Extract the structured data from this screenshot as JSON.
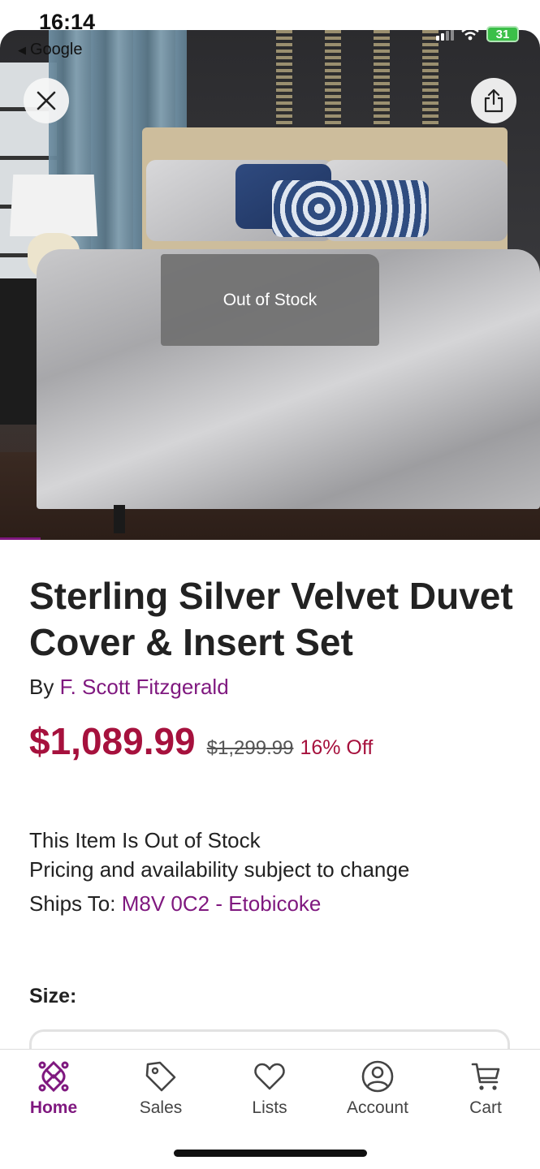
{
  "status_bar": {
    "time": "16:14",
    "back_app": "Google",
    "battery": "31"
  },
  "hero": {
    "overlay_text": "Out of Stock",
    "close_icon": "close-icon",
    "share_icon": "share-icon"
  },
  "product": {
    "title": "Sterling Silver Velvet Duvet Cover & Insert Set",
    "by_prefix": "By",
    "brand": "F. Scott Fitzgerald",
    "price": "$1,089.99",
    "old_price": "$1,299.99",
    "discount": "16% Off"
  },
  "availability": {
    "stock_status": "This Item Is Out of Stock",
    "pricing_note": "Pricing and availability subject to change",
    "ships_to_label": "Ships To:",
    "ships_to_value": "M8V 0C2 - Etobicoke"
  },
  "options": {
    "size_label": "Size:"
  },
  "nav": {
    "items": [
      {
        "label": "Home",
        "icon": "home-logo-icon",
        "active": true
      },
      {
        "label": "Sales",
        "icon": "tag-icon",
        "active": false
      },
      {
        "label": "Lists",
        "icon": "heart-icon",
        "active": false
      },
      {
        "label": "Account",
        "icon": "account-icon",
        "active": false
      },
      {
        "label": "Cart",
        "icon": "cart-icon",
        "active": false
      }
    ]
  },
  "colors": {
    "brand_purple": "#7f187f",
    "price_red": "#a6113d",
    "battery_green": "#3bbf48"
  }
}
